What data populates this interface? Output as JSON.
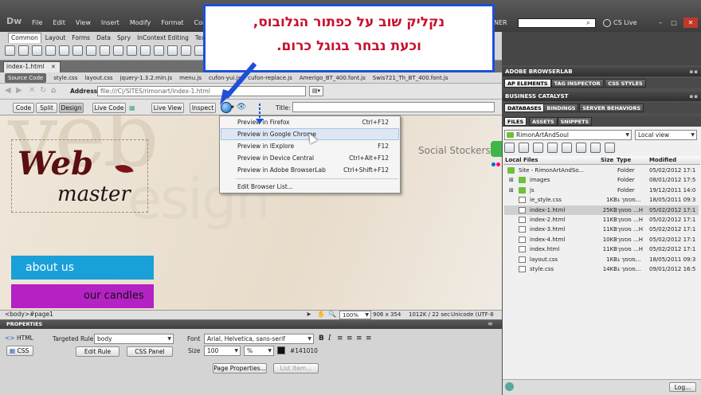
{
  "app": {
    "logo": "Dw",
    "menu": [
      "File",
      "Edit",
      "View",
      "Insert",
      "Modify",
      "Format",
      "Comma"
    ],
    "designer": "NER",
    "cslive": "CS Live"
  },
  "insert_bar": {
    "tabs": [
      "Common",
      "Layout",
      "Forms",
      "Data",
      "Spry",
      "InContext Editing",
      "Text"
    ]
  },
  "doc": {
    "tab": "index-1.html",
    "related": [
      "Source Code",
      "style.css",
      "layout.css",
      "jquery-1.3.2.min.js",
      "menu.js",
      "cufon-yui.js",
      "cufon-replace.js",
      "Amerigo_BT_400.font.js",
      "Swis721_Th_BT_400.font.js"
    ],
    "address_label": "Address:",
    "address_value": "file:///C|/SITES/rimonart/index-1.html",
    "title_label": "Title:",
    "views": [
      "Code",
      "Split",
      "Design",
      "Live Code",
      "Live View",
      "Inspect"
    ],
    "status_tag": "<body>#page1",
    "status_zoom": "100%",
    "status_size": "906 x 354",
    "status_weight": "1012K / 22 sec",
    "status_enc": "Unicode (UTF-8"
  },
  "callout": {
    "line1": "נקליק שוב על כפתור הגלובוס,",
    "line2": "וכעת נבחר בגוגל כרום."
  },
  "browser_menu": [
    {
      "label": "Preview in Firefox",
      "shortcut": "Ctrl+F12"
    },
    {
      "label": "Preview in Google Chrome",
      "shortcut": ""
    },
    {
      "label": "Preview in IExplore",
      "shortcut": "F12"
    },
    {
      "label": "Preview in Device Central",
      "shortcut": "Ctrl+Alt+F12"
    },
    {
      "label": "Preview in Adobe BrowserLab",
      "shortcut": "Ctrl+Shift+F12"
    },
    {
      "label": "Edit Browser List...",
      "shortcut": ""
    }
  ],
  "site": {
    "logo_top": "Web",
    "logo_bottom": "master",
    "social": "Social Stockers",
    "nav": [
      "about us",
      "our candles"
    ],
    "bg_text_1": "veb",
    "bg_text_2": "esign"
  },
  "properties": {
    "header": "PROPERTIES",
    "html_btn": "HTML",
    "css_btn": "CSS",
    "targeted_rule_label": "Targeted Rule",
    "targeted_rule_value": "body",
    "edit_rule": "Edit Rule",
    "css_panel": "CSS Panel",
    "font_label": "Font",
    "font_value": "Arial, Helvetica, sans-serif",
    "size_label": "Size",
    "size_value": "100",
    "unit_value": "%",
    "color_value": "#141010",
    "page_properties": "Page Properties...",
    "list_item": "List Item..."
  },
  "panels": {
    "browserlab": "ADOBE BROWSERLAB",
    "ap_tabs": [
      "AP ELEMENTS",
      "TAG INSPECTOR",
      "CSS STYLES"
    ],
    "catalyst": "BUSINESS CATALYST",
    "db_tabs": [
      "DATABASES",
      "BINDINGS",
      "SERVER BEHAVIORS"
    ],
    "files_tabs": [
      "FILES",
      "ASSETS",
      "SNIPPETS"
    ],
    "site_select": "RimonArtAndSoul",
    "view_select": "Local view",
    "columns": [
      "Local Files",
      "Size",
      "Type",
      "Modified"
    ],
    "files": [
      {
        "name": "Site - RimonArtAndSo...",
        "size": "",
        "type": "Folder",
        "modified": "05/02/2012 17:1",
        "indent": 0,
        "kind": "site"
      },
      {
        "name": "images",
        "size": "",
        "type": "Folder",
        "modified": "08/01/2012 17:5",
        "indent": 1,
        "kind": "folder"
      },
      {
        "name": "js",
        "size": "",
        "type": "Folder",
        "modified": "19/12/2011 14:0",
        "indent": 1,
        "kind": "folder"
      },
      {
        "name": "ie_style.css",
        "size": "1KB",
        "type": "מסמך ג...",
        "modified": "18/05/2011 09:3",
        "indent": 1,
        "kind": "css"
      },
      {
        "name": "index-1.html",
        "size": "25KB",
        "type": "מסמך ...H",
        "modified": "05/02/2012 17:1",
        "indent": 1,
        "kind": "html"
      },
      {
        "name": "index-2.html",
        "size": "11KB",
        "type": "מסמך ...H",
        "modified": "05/02/2012 17:1",
        "indent": 1,
        "kind": "html"
      },
      {
        "name": "index-3.html",
        "size": "11KB",
        "type": "מסמך ...H",
        "modified": "05/02/2012 17:1",
        "indent": 1,
        "kind": "html"
      },
      {
        "name": "index-4.html",
        "size": "10KB",
        "type": "מסמך ...H",
        "modified": "05/02/2012 17:1",
        "indent": 1,
        "kind": "html"
      },
      {
        "name": "index.html",
        "size": "11KB",
        "type": "מסמך ...H",
        "modified": "05/02/2012 17:1",
        "indent": 1,
        "kind": "html"
      },
      {
        "name": "layout.css",
        "size": "1KB",
        "type": "מסמך ג...",
        "modified": "18/05/2011 09:3",
        "indent": 1,
        "kind": "css"
      },
      {
        "name": "style.css",
        "size": "14KB",
        "type": "מסמך ג...",
        "modified": "09/01/2012 16:5",
        "indent": 1,
        "kind": "css"
      }
    ],
    "log_btn": "Log..."
  },
  "colors": {
    "callout_text": "#c8102e",
    "callout_border": "#1e4fd8",
    "nav_blue": "#1aa0d8",
    "nav_purple": "#b422c4",
    "logo": "#5a0e12"
  }
}
